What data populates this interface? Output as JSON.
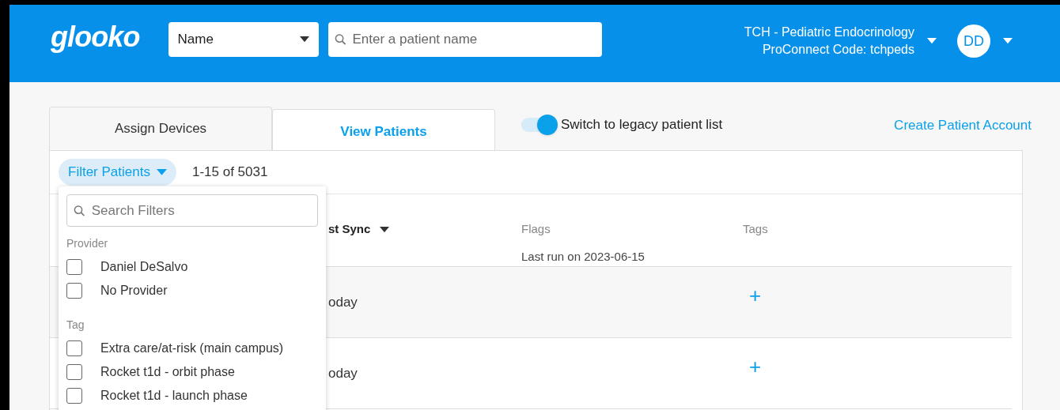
{
  "header": {
    "logo": "glooko",
    "search_by": "Name",
    "search_placeholder": "Enter a patient name",
    "clinic": "TCH - Pediatric Endocrinology",
    "code": "ProConnect Code: tchpeds",
    "avatar": "DD"
  },
  "tabs": [
    {
      "label": "Assign Devices",
      "selected": false
    },
    {
      "label": "View Patients",
      "selected": true
    }
  ],
  "legacy_toggle": {
    "label": "Switch to legacy patient list",
    "on": true
  },
  "create_link": "Create Patient Account",
  "filter_button": "Filter Patients",
  "count": "1-15 of 5031",
  "table": {
    "columns": [
      {
        "label": "st Sync",
        "sorted": true
      },
      {
        "label": "Flags",
        "sublabel": "Last run on 2023-06-15"
      },
      {
        "label": "Tags"
      }
    ],
    "rows": [
      {
        "last_sync": "oday",
        "tags": "+"
      },
      {
        "last_sync": "oday",
        "tags": "+"
      }
    ]
  },
  "filter_panel": {
    "search_placeholder": "Search Filters",
    "groups": [
      {
        "title": "Provider",
        "options": [
          {
            "label": "Daniel DeSalvo",
            "checked": false
          },
          {
            "label": "No Provider",
            "checked": false
          }
        ]
      },
      {
        "title": "Tag",
        "options": [
          {
            "label": "Extra care/at-risk (main campus)",
            "checked": false
          },
          {
            "label": "Rocket t1d - orbit phase",
            "checked": false
          },
          {
            "label": "Rocket t1d - launch phase",
            "checked": false
          }
        ]
      }
    ]
  }
}
